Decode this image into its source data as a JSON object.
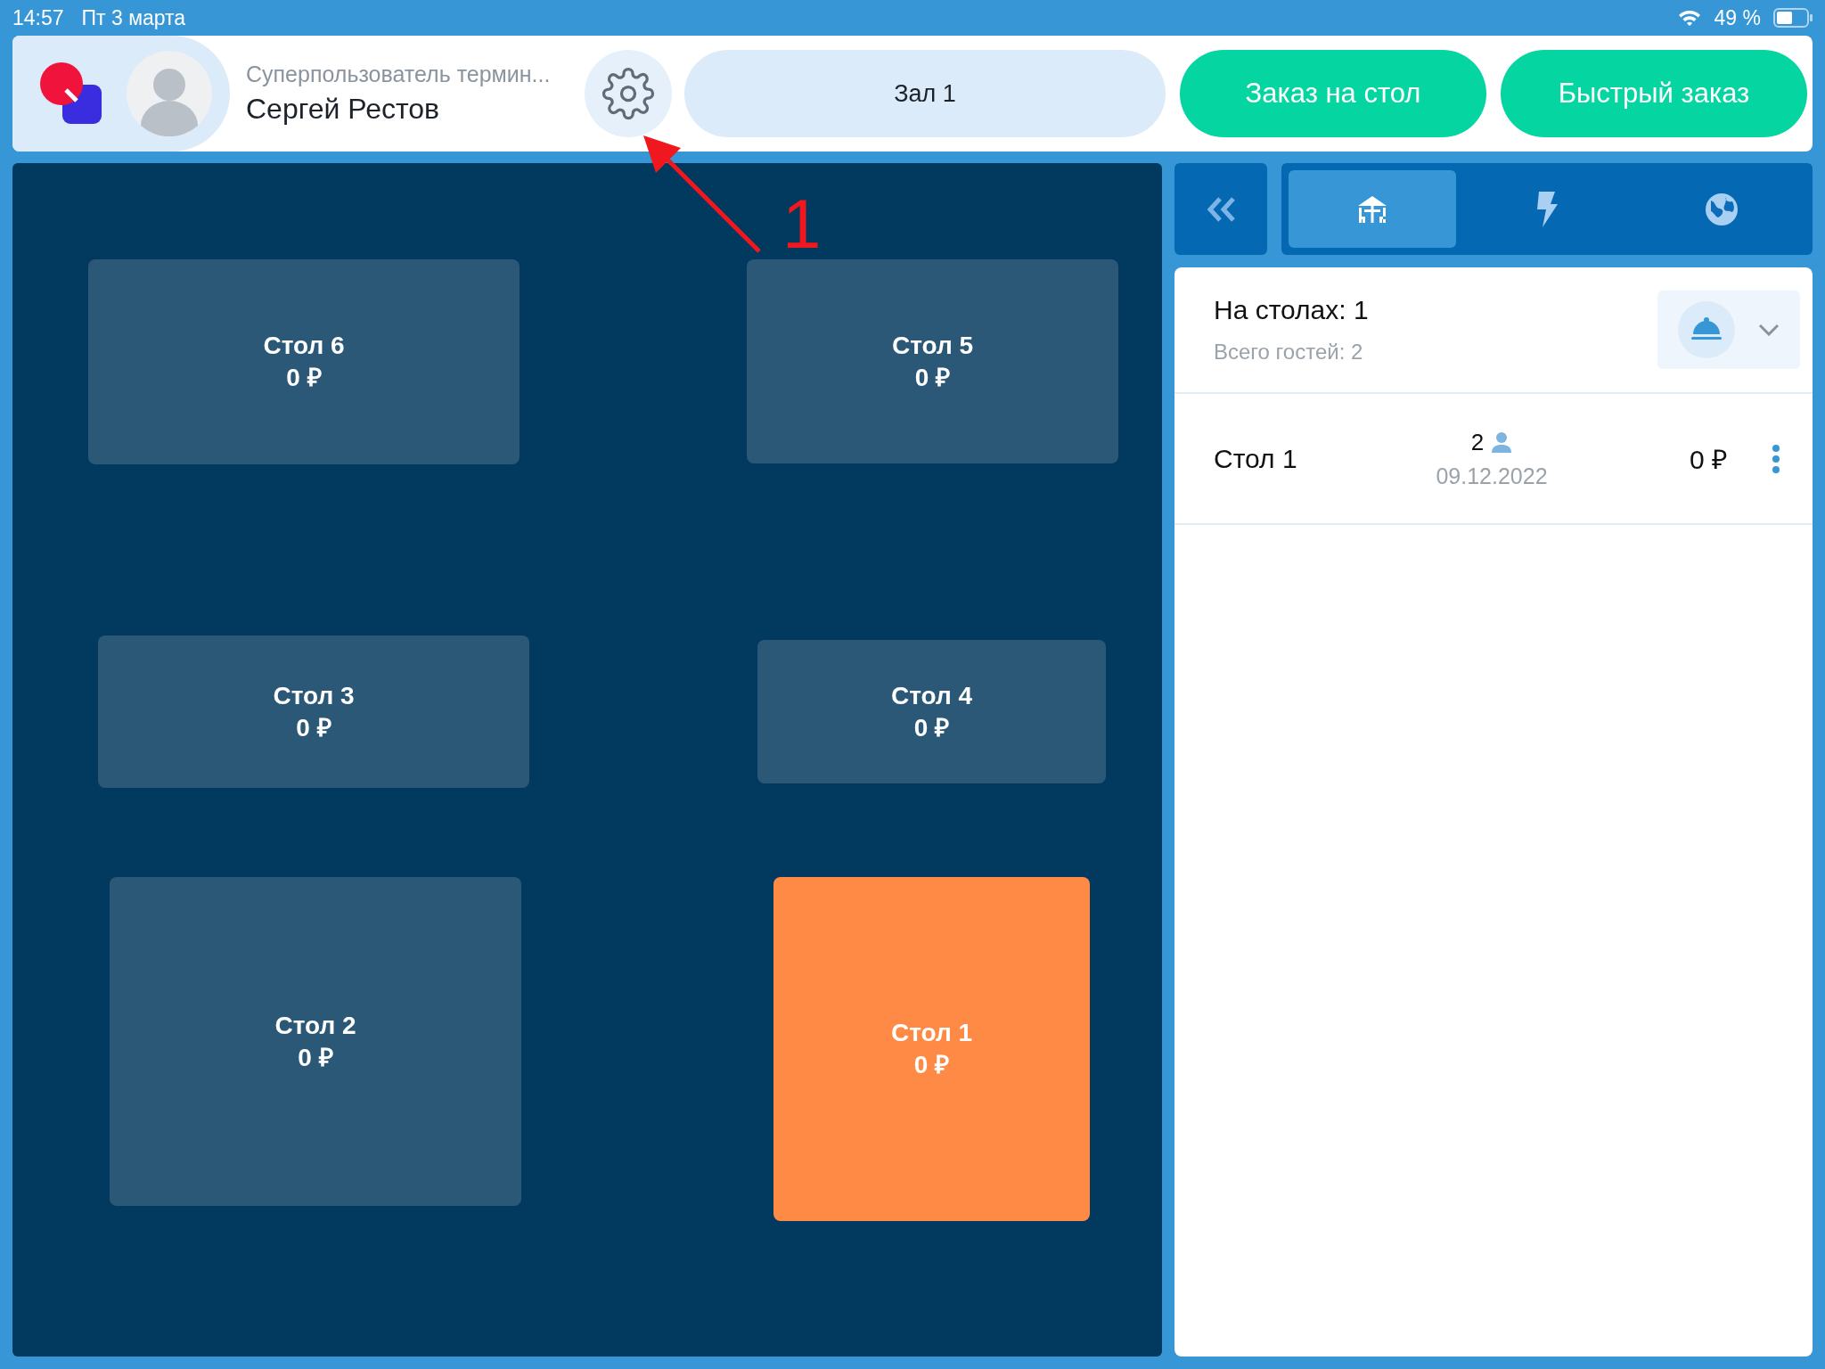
{
  "status_bar": {
    "time": "14:57",
    "date": "Пт 3 марта",
    "battery": "49 %"
  },
  "header": {
    "user_role": "Суперпользователь термин...",
    "user_name": "Сергей Рестов",
    "hall": "Зал 1",
    "buttons": [
      "Заказ на стол",
      "Быстрый заказ"
    ]
  },
  "floor": {
    "tables": [
      {
        "name": "Стол 6",
        "amount": "0 ₽",
        "selected": false
      },
      {
        "name": "Стол 5",
        "amount": "0 ₽",
        "selected": false
      },
      {
        "name": "Стол 3",
        "amount": "0 ₽",
        "selected": false
      },
      {
        "name": "Стол 4",
        "amount": "0 ₽",
        "selected": false
      },
      {
        "name": "Стол 2",
        "amount": "0 ₽",
        "selected": false
      },
      {
        "name": "Стол 1",
        "amount": "0 ₽",
        "selected": true
      }
    ]
  },
  "annotation": {
    "label": "1"
  },
  "side_panel": {
    "tabs": [
      {
        "kind": "tables",
        "selected": true
      },
      {
        "kind": "quick",
        "selected": false
      },
      {
        "kind": "online",
        "selected": false
      }
    ],
    "summary": {
      "title": "На столах: 1",
      "guests": "Всего гостей: 2"
    },
    "orders": [
      {
        "table": "Стол 1",
        "guests": "2",
        "date": "09.12.2022",
        "amount": "0 ₽"
      }
    ]
  }
}
